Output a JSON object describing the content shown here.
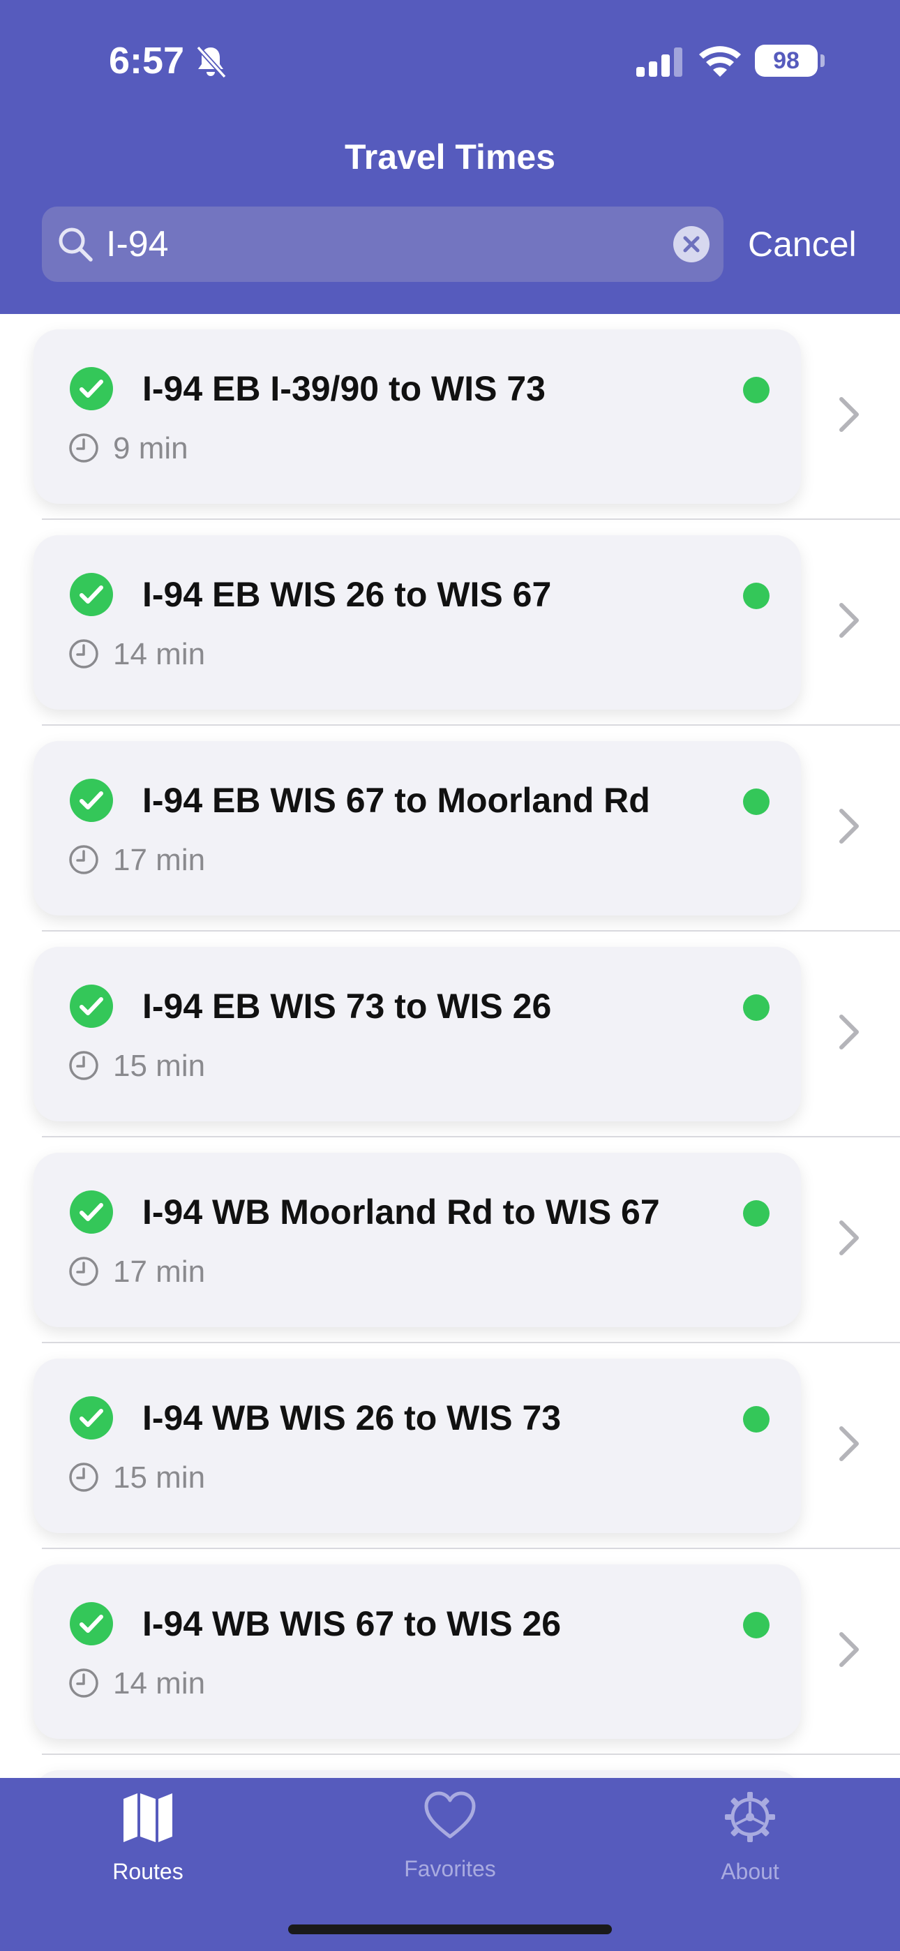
{
  "status_bar": {
    "time": "6:57",
    "battery": "98"
  },
  "nav": {
    "title": "Travel Times"
  },
  "search": {
    "value": "I-94",
    "cancel_label": "Cancel"
  },
  "colors": {
    "header": "#565bbd",
    "status_ok": "#34c759",
    "card": "#f2f2f7"
  },
  "routes": [
    {
      "name": "I-94 EB I-39/90 to WIS 73",
      "duration": "9 min"
    },
    {
      "name": "I-94 EB WIS 26 to WIS 67",
      "duration": "14 min"
    },
    {
      "name": "I-94 EB WIS 67 to Moorland Rd",
      "duration": "17 min"
    },
    {
      "name": "I-94 EB WIS 73 to WIS 26",
      "duration": "15 min"
    },
    {
      "name": "I-94 WB Moorland Rd to WIS 67",
      "duration": "17 min"
    },
    {
      "name": "I-94 WB WIS 26 to WIS 73",
      "duration": "15 min"
    },
    {
      "name": "I-94 WB WIS 67 to WIS 26",
      "duration": "14 min"
    }
  ],
  "tabs": [
    {
      "label": "Routes",
      "icon": "map-icon",
      "selected": true
    },
    {
      "label": "Favorites",
      "icon": "heart-icon",
      "selected": false
    },
    {
      "label": "About",
      "icon": "gear-icon",
      "selected": false
    }
  ]
}
